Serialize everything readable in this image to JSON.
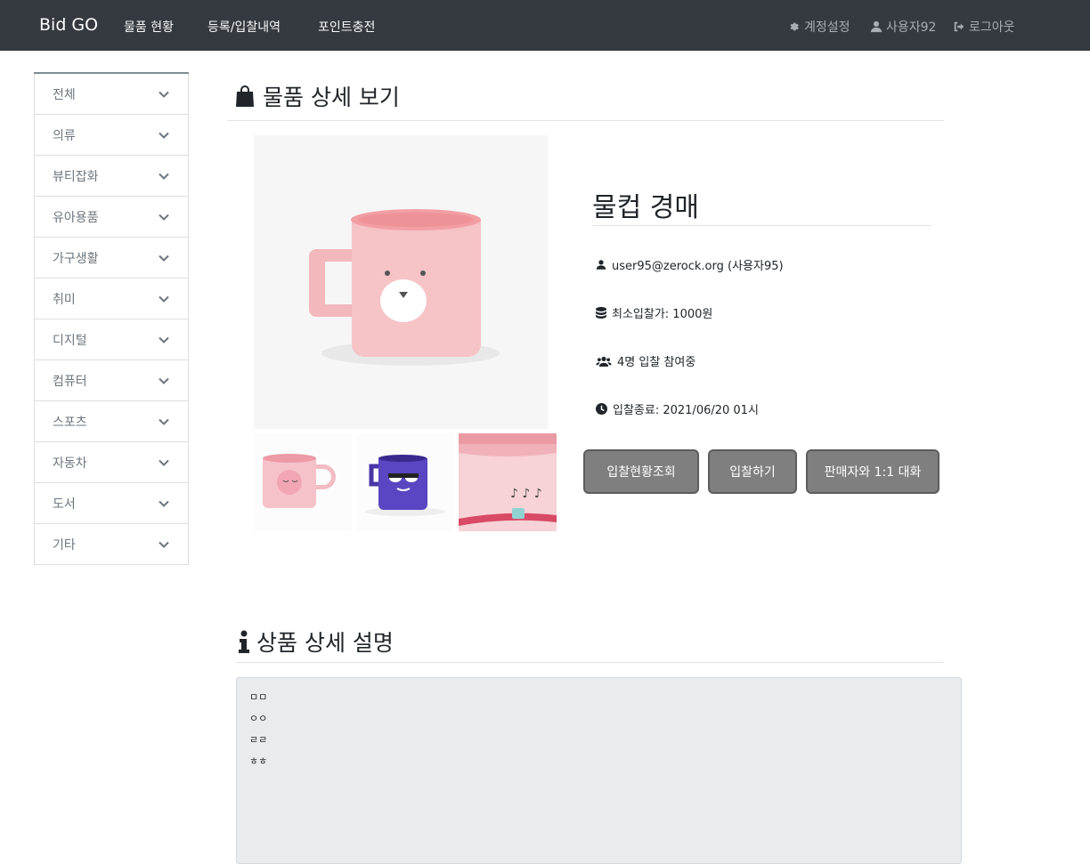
{
  "navbar": {
    "brand": "Bid GO",
    "links": [
      {
        "label": "물품 현황"
      },
      {
        "label": "등록/입찰내역"
      },
      {
        "label": "포인트충전"
      }
    ],
    "right": {
      "settings_label": "계정설정",
      "user_label": "사용자92",
      "logout_label": "로그아웃"
    }
  },
  "sidebar": {
    "items": [
      {
        "label": "전체"
      },
      {
        "label": "의류"
      },
      {
        "label": "뷰티잡화"
      },
      {
        "label": "유아용품"
      },
      {
        "label": "가구생활"
      },
      {
        "label": "취미"
      },
      {
        "label": "디지털"
      },
      {
        "label": "컴퓨터"
      },
      {
        "label": "스포츠"
      },
      {
        "label": "자동차"
      },
      {
        "label": "도서"
      },
      {
        "label": "기타"
      }
    ]
  },
  "detail": {
    "heading": "물품 상세 보기",
    "item_title": "물컵 경매",
    "seller": "user95@zerock.org (사용자95)",
    "min_bid": "최소입찰가: 1000원",
    "participants": "4명 입찰 참여중",
    "end_time": "입찰종료: 2021/06/20 01시",
    "buttons": {
      "bid_status": "입찰현황조회",
      "bid": "입찰하기",
      "chat": "판매자와 1:1 대화"
    }
  },
  "description": {
    "heading": "상품 상세 설명",
    "lines": [
      "ㅁㅁ",
      "ㅇㅇ",
      "ㄹㄹ",
      "ㅎㅎ"
    ]
  },
  "colors": {
    "navbar_bg": "#343a40",
    "button_bg": "#7f7f7f",
    "desc_bg": "#e9ecef"
  }
}
